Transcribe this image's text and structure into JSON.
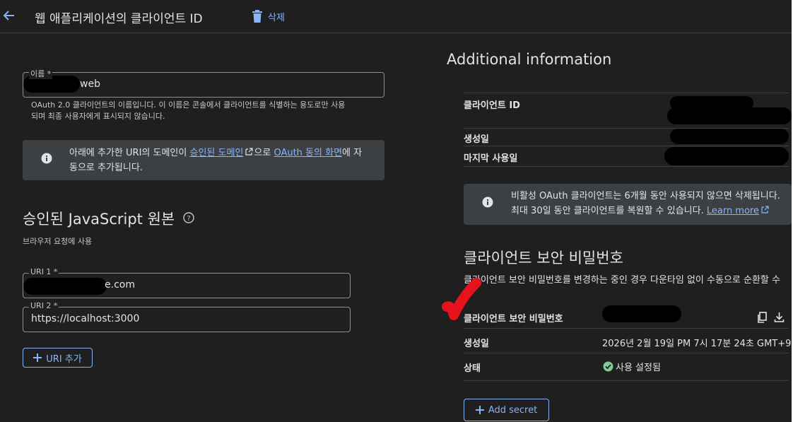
{
  "header": {
    "title": "웹 애플리케이션의 클라이언트 ID",
    "delete_label": "삭제"
  },
  "name_field": {
    "label": "이름 *",
    "value_suffix": "web",
    "help_line1": "OAuth 2.0 클라이언트의 이름입니다. 이 이름은 콘솔에서 클라이언트를 식별하는 용도로만 사용",
    "help_line2": "되며 최종 사용자에게 표시되지 않습니다."
  },
  "info_notice": {
    "text_before": "아래에 추가한 URI의 도메인이 ",
    "link1": "승인된 도메인",
    "text_middle": "으로 ",
    "link2": "OAuth 동의 화면",
    "text_after": "에 자",
    "line2": "동으로 추가됩니다."
  },
  "js_origins": {
    "title": "승인된 JavaScript 원본",
    "subtitle": "브라우저 요청에 사용",
    "uri1_label": "URI 1 *",
    "uri1_value_suffix": "e.com",
    "uri2_label": "URI 2 *",
    "uri2_value": "https://localhost:3000",
    "add_uri_label": "URI 추가"
  },
  "additional": {
    "title": "Additional information",
    "client_id_label": "클라이언트 ID",
    "created_label": "생성일",
    "last_used_label": "마지막 사용일",
    "inactive_notice_line1": "비활성 OAuth 클라이언트는 6개월 동안 사용되지 않으면 삭제됩니다.",
    "inactive_notice_line2": "최대 30일 동안 클라이언트를 복원할 수 있습니다. ",
    "learn_more": "Learn more"
  },
  "secret": {
    "title": "클라이언트 보안 비밀번호",
    "description": "클라이언트 보안 비밀번호를 변경하는 중인 경우 다운타임 없이 수동으로 순환할 수",
    "secret_label": "클라이언트 보안 비밀번호",
    "created_label": "생성일",
    "created_value": "2026년 2월 19일 PM 7시 17분 24초 GMT+9",
    "status_label": "상태",
    "status_value": "사용 설정됨",
    "add_secret_label": "Add secret"
  },
  "colors": {
    "accent": "#8ab4f8",
    "background": "#1f1f1f",
    "enabled_green": "#81c995",
    "annotation_red": "#e8121c"
  },
  "icons": [
    "arrow-back-icon",
    "trash-icon",
    "info-icon",
    "help-icon",
    "plus-icon",
    "external-link-icon",
    "copy-icon",
    "download-icon",
    "check-circle-icon"
  ]
}
